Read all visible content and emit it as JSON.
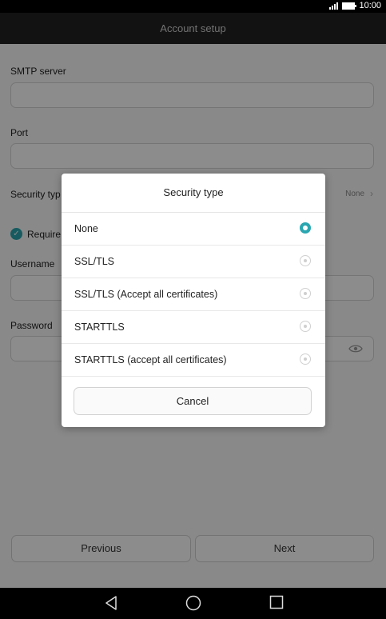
{
  "status_bar": {
    "time": "10:00"
  },
  "app_bar": {
    "title": "Account setup"
  },
  "form": {
    "smtp_label": "SMTP server",
    "smtp_value": "",
    "port_label": "Port",
    "port_value": "",
    "security_label": "Security typ",
    "security_value": "None",
    "require_label": "Require",
    "username_label": "Username",
    "username_value": "",
    "password_label": "Password",
    "password_value": ""
  },
  "buttons": {
    "previous": "Previous",
    "next": "Next"
  },
  "dialog": {
    "title": "Security type",
    "options": [
      {
        "label": "None",
        "selected": true
      },
      {
        "label": "SSL/TLS",
        "selected": false
      },
      {
        "label": "SSL/TLS (Accept all certificates)",
        "selected": false
      },
      {
        "label": "STARTTLS",
        "selected": false
      },
      {
        "label": "STARTTLS (accept all certificates)",
        "selected": false
      }
    ],
    "cancel": "Cancel"
  },
  "colors": {
    "accent": "#2aa7b0",
    "app_bar": "#222222"
  }
}
